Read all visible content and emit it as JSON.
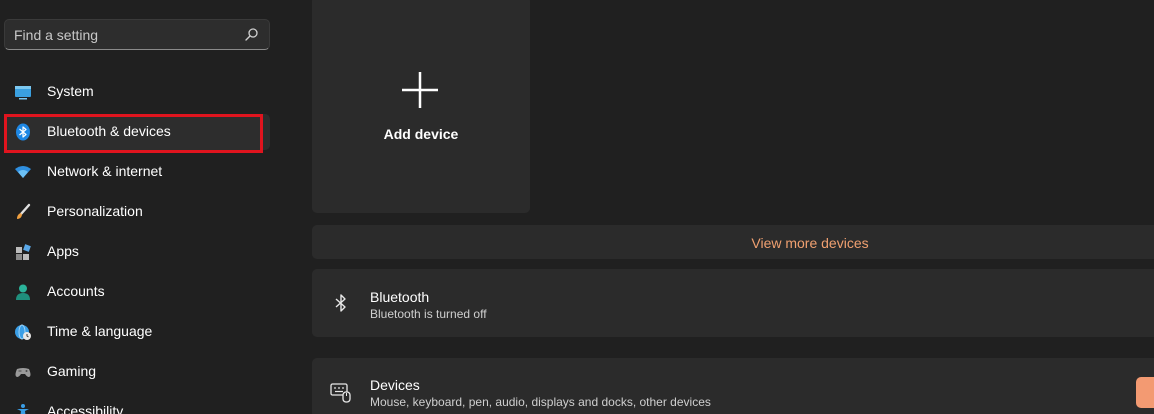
{
  "search": {
    "placeholder": "Find a setting"
  },
  "sidebar": {
    "items": [
      {
        "label": "System",
        "icon": "monitor-icon"
      },
      {
        "label": "Bluetooth & devices",
        "icon": "bluetooth-icon",
        "active": true
      },
      {
        "label": "Network & internet",
        "icon": "wifi-icon"
      },
      {
        "label": "Personalization",
        "icon": "brush-icon"
      },
      {
        "label": "Apps",
        "icon": "apps-icon"
      },
      {
        "label": "Accounts",
        "icon": "person-icon"
      },
      {
        "label": "Time & language",
        "icon": "globe-clock-icon"
      },
      {
        "label": "Gaming",
        "icon": "gamepad-icon"
      },
      {
        "label": "Accessibility",
        "icon": "accessibility-icon"
      }
    ]
  },
  "main": {
    "add_device_label": "Add device",
    "view_more_label": "View more devices",
    "bluetooth": {
      "title": "Bluetooth",
      "subtitle": "Bluetooth is turned off"
    },
    "devices": {
      "title": "Devices",
      "subtitle": "Mouse, keyboard, pen, audio, displays and docks, other devices"
    }
  },
  "colors": {
    "background": "#202020",
    "card": "#2b2b2b",
    "accent_link": "#f0a070",
    "highlight_box": "#e0141e",
    "toggle": "#f39a72"
  }
}
